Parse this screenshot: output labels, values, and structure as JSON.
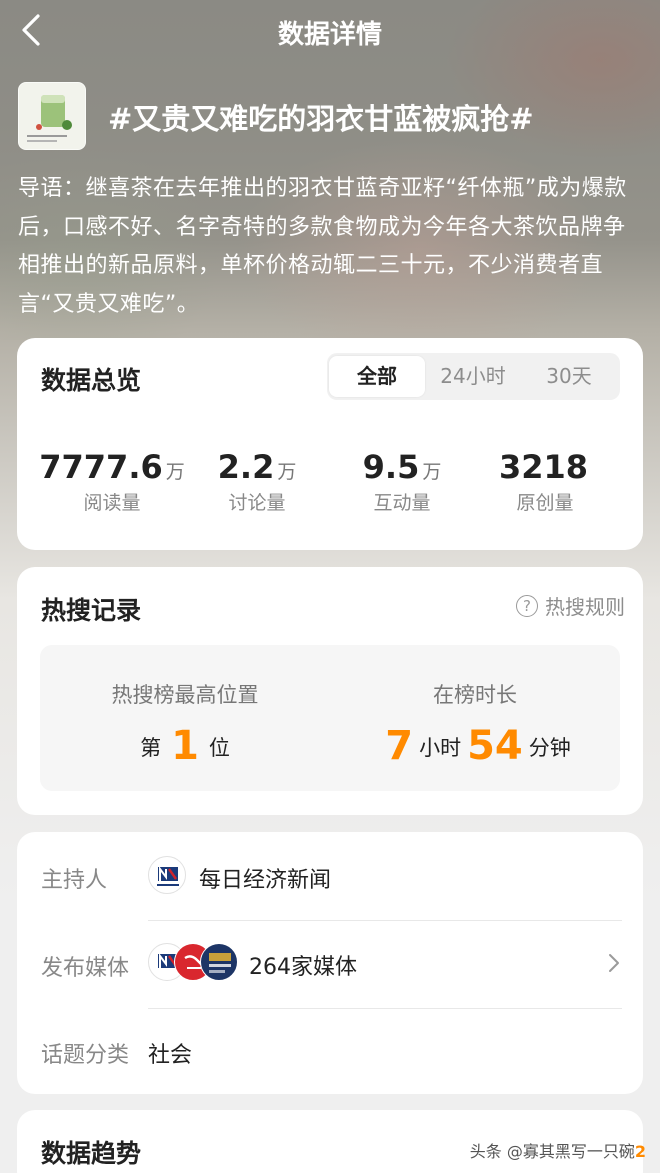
{
  "nav": {
    "title": "数据详情",
    "back_icon": "chevron-left-icon"
  },
  "topic": {
    "title": "#又贵又难吃的羽衣甘蓝被疯抢#",
    "lead": "导语：继喜茶在去年推出的羽衣甘蓝奇亚籽“纤体瓶”成为爆款后，口感不好、名字奇特的多款食物成为今年各大茶饮品牌争相推出的新品原料，单杯价格动辄二三十元，不少消费者直言“又贵又难吃”。"
  },
  "overview": {
    "title": "数据总览",
    "tabs": [
      {
        "label": "全部",
        "active": true
      },
      {
        "label": "24小时",
        "active": false
      },
      {
        "label": "30天",
        "active": false
      }
    ],
    "stats": [
      {
        "value": "7777.6",
        "unit": "万",
        "label": "阅读量"
      },
      {
        "value": "2.2",
        "unit": "万",
        "label": "讨论量"
      },
      {
        "value": "9.5",
        "unit": "万",
        "label": "互动量"
      },
      {
        "value": "3218",
        "unit": "",
        "label": "原创量"
      }
    ]
  },
  "hot": {
    "title": "热搜记录",
    "rules_label": "热搜规则",
    "rules_icon": "question-circle-icon",
    "peak": {
      "label": "热搜榜最高位置",
      "prefix": "第",
      "value": "1",
      "suffix": "位"
    },
    "duration": {
      "label": "在榜时长",
      "hours": "7",
      "hours_unit": "小时",
      "minutes": "54",
      "minutes_unit": "分钟"
    }
  },
  "info": {
    "host_label": "主持人",
    "host_name": "每日经济新闻",
    "media_label": "发布媒体",
    "media_count": "264家媒体",
    "category_label": "话题分类",
    "category": "社会"
  },
  "trend": {
    "title": "数据趋势"
  },
  "watermark": {
    "text": "头条 @寡其黑写一只碗"
  },
  "colors": {
    "accent": "#ff8a00",
    "card_bg": "#ffffff",
    "muted": "#888888"
  }
}
